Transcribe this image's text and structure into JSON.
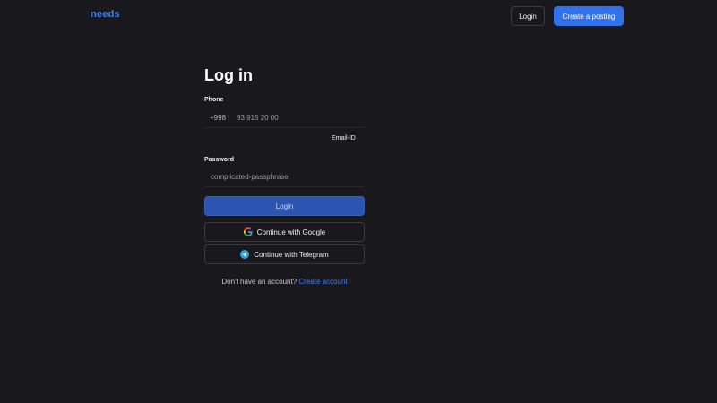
{
  "header": {
    "logo": "needs",
    "login_label": "Login",
    "create_label": "Create a posting"
  },
  "form": {
    "title": "Log in",
    "phone": {
      "label": "Phone",
      "prefix": "+998",
      "placeholder": "93 915 20 00"
    },
    "email_switch_label": "Email-ID",
    "password": {
      "label": "Password",
      "placeholder": "complicated-passphrase"
    },
    "submit_label": "Login",
    "google_label": "Continue with Google",
    "telegram_label": "Continue with Telegram",
    "footer_text": "Don't have an account?",
    "footer_link": "Create account"
  },
  "icons": {
    "google": "google-icon",
    "telegram": "telegram-icon"
  },
  "colors": {
    "background": "#19191d",
    "accent": "#2f72ea",
    "link": "#3b82f6",
    "telegram": "#2aa3df"
  }
}
